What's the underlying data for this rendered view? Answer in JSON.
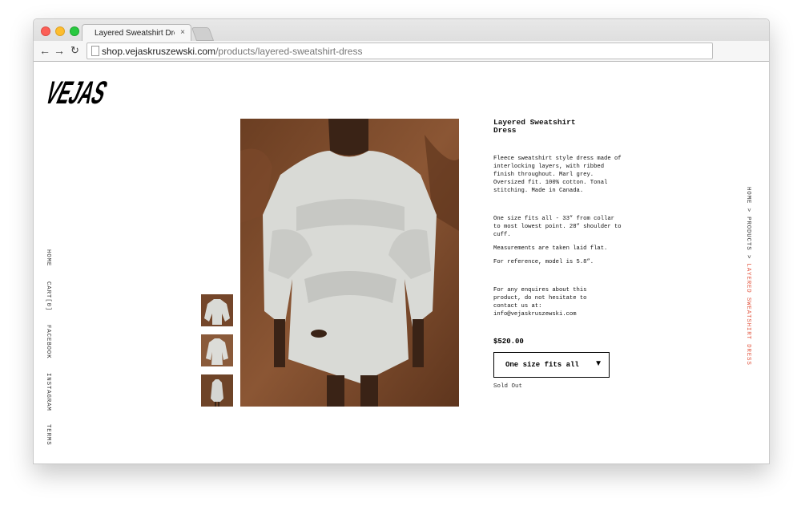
{
  "browser": {
    "tab_title": "Layered Sweatshirt Dress –",
    "tab_close": "×",
    "url_domain": "shop.vejaskruszewski.com",
    "url_path": "/products/layered-sweatshirt-dress"
  },
  "brand": {
    "logo_text": "VEJAS"
  },
  "side_nav": [
    "HOME",
    "CART[0]",
    "FACEBOOK",
    "INSTAGRAM",
    "TERMS"
  ],
  "product": {
    "title": "Layered Sweatshirt Dress",
    "description": "Fleece sweatshirt style dress made of interlocking layers, with ribbed finish throughout. Marl grey. Oversized fit. 100% cotton. Tonal stitching. Made in Canada.",
    "size_note": "One size fits all - 33” from collar to most lowest point. 28” shoulder to cuff.",
    "measure_note": "Measurements are taken laid flat.",
    "model_note": "For reference, model is 5.8”.",
    "enquiry": "For any enquires about this product, do not hesitate to contact us at: info@vejaskruszewski.com",
    "price": "$520.00",
    "size_selected": "One size fits all",
    "status": "Sold Out"
  },
  "breadcrumb": {
    "home": "HOME",
    "sep1": " > ",
    "products": "PRODUCTS",
    "sep2": " > ",
    "current": "LAYERED SWEATSHIRT DRESS"
  },
  "colors": {
    "accent": "#e2553f",
    "photo_background": "#7a4a2c",
    "garment": "#d9dad6"
  }
}
